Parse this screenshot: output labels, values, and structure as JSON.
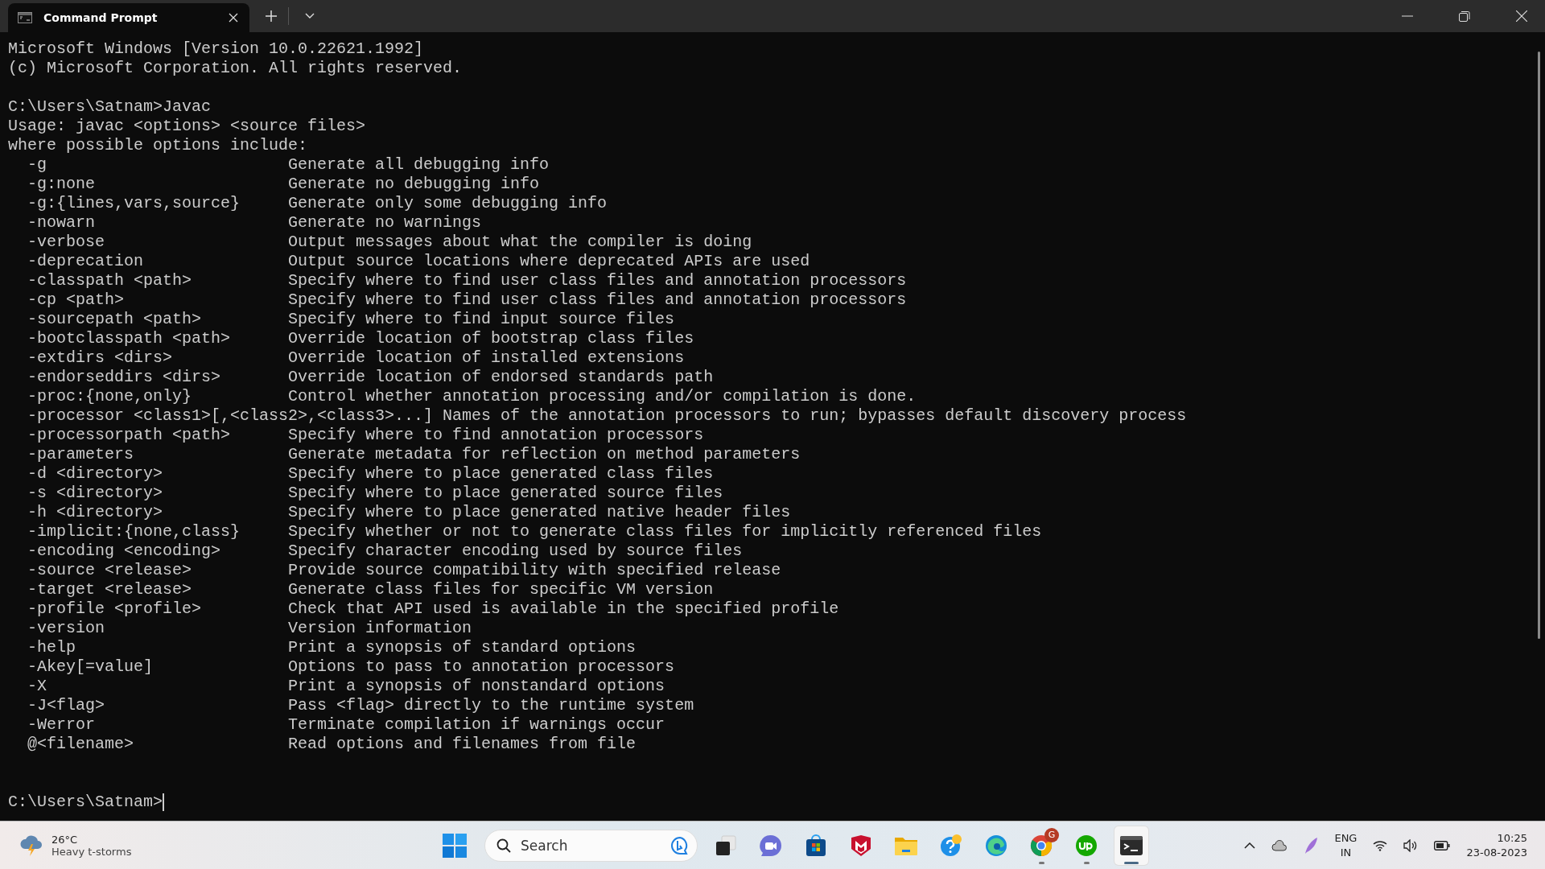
{
  "window": {
    "tab_title": "Command Prompt"
  },
  "terminal": {
    "lines": [
      {
        "kind": "text",
        "text": "Microsoft Windows [Version 10.0.22621.1992]"
      },
      {
        "kind": "text",
        "text": "(c) Microsoft Corporation. All rights reserved."
      },
      {
        "kind": "blank"
      },
      {
        "kind": "text",
        "text": "C:\\Users\\Satnam>Javac"
      },
      {
        "kind": "text",
        "text": "Usage: javac <options> <source files>"
      },
      {
        "kind": "text",
        "text": "where possible options include:"
      },
      {
        "kind": "option",
        "option": "-g",
        "description": "Generate all debugging info"
      },
      {
        "kind": "option",
        "option": "-g:none",
        "description": "Generate no debugging info"
      },
      {
        "kind": "option",
        "option": "-g:{lines,vars,source}",
        "description": "Generate only some debugging info"
      },
      {
        "kind": "option",
        "option": "-nowarn",
        "description": "Generate no warnings"
      },
      {
        "kind": "option",
        "option": "-verbose",
        "description": "Output messages about what the compiler is doing"
      },
      {
        "kind": "option",
        "option": "-deprecation",
        "description": "Output source locations where deprecated APIs are used"
      },
      {
        "kind": "option",
        "option": "-classpath <path>",
        "description": "Specify where to find user class files and annotation processors"
      },
      {
        "kind": "option",
        "option": "-cp <path>",
        "description": "Specify where to find user class files and annotation processors"
      },
      {
        "kind": "option",
        "option": "-sourcepath <path>",
        "description": "Specify where to find input source files"
      },
      {
        "kind": "option",
        "option": "-bootclasspath <path>",
        "description": "Override location of bootstrap class files"
      },
      {
        "kind": "option",
        "option": "-extdirs <dirs>",
        "description": "Override location of installed extensions"
      },
      {
        "kind": "option",
        "option": "-endorseddirs <dirs>",
        "description": "Override location of endorsed standards path"
      },
      {
        "kind": "option",
        "option": "-proc:{none,only}",
        "description": "Control whether annotation processing and/or compilation is done."
      },
      {
        "kind": "option",
        "option": "-processor <class1>[,<class2>,<class3>...]",
        "description": "Names of the annotation processors to run; bypasses default discovery process"
      },
      {
        "kind": "option",
        "option": "-processorpath <path>",
        "description": "Specify where to find annotation processors"
      },
      {
        "kind": "option",
        "option": "-parameters",
        "description": "Generate metadata for reflection on method parameters"
      },
      {
        "kind": "option",
        "option": "-d <directory>",
        "description": "Specify where to place generated class files"
      },
      {
        "kind": "option",
        "option": "-s <directory>",
        "description": "Specify where to place generated source files"
      },
      {
        "kind": "option",
        "option": "-h <directory>",
        "description": "Specify where to place generated native header files"
      },
      {
        "kind": "option",
        "option": "-implicit:{none,class}",
        "description": "Specify whether or not to generate class files for implicitly referenced files"
      },
      {
        "kind": "option",
        "option": "-encoding <encoding>",
        "description": "Specify character encoding used by source files"
      },
      {
        "kind": "option",
        "option": "-source <release>",
        "description": "Provide source compatibility with specified release"
      },
      {
        "kind": "option",
        "option": "-target <release>",
        "description": "Generate class files for specific VM version"
      },
      {
        "kind": "option",
        "option": "-profile <profile>",
        "description": "Check that API used is available in the specified profile"
      },
      {
        "kind": "option",
        "option": "-version",
        "description": "Version information"
      },
      {
        "kind": "option",
        "option": "-help",
        "description": "Print a synopsis of standard options"
      },
      {
        "kind": "option",
        "option": "-Akey[=value]",
        "description": "Options to pass to annotation processors"
      },
      {
        "kind": "option",
        "option": "-X",
        "description": "Print a synopsis of nonstandard options"
      },
      {
        "kind": "option",
        "option": "-J<flag>",
        "description": "Pass <flag> directly to the runtime system"
      },
      {
        "kind": "option",
        "option": "-Werror",
        "description": "Terminate compilation if warnings occur"
      },
      {
        "kind": "option",
        "option": "@<filename>",
        "description": "Read options and filenames from file"
      },
      {
        "kind": "blank"
      },
      {
        "kind": "blank"
      },
      {
        "kind": "prompt",
        "text": "C:\\Users\\Satnam>"
      }
    ]
  },
  "taskbar": {
    "weather": {
      "temperature": "26°C",
      "condition": "Heavy t-storms"
    },
    "search": {
      "placeholder": "Search"
    },
    "apps": [
      {
        "kind": "task-view",
        "running": false,
        "selected": false
      },
      {
        "kind": "chat",
        "running": false,
        "selected": false
      },
      {
        "kind": "store",
        "running": false,
        "selected": false
      },
      {
        "kind": "shield",
        "running": false,
        "selected": false
      },
      {
        "kind": "folder",
        "running": false,
        "selected": false
      },
      {
        "kind": "help",
        "running": false,
        "selected": false
      },
      {
        "kind": "edge",
        "running": false,
        "selected": false
      },
      {
        "kind": "chrome",
        "running": true,
        "selected": false,
        "badge": "G"
      },
      {
        "kind": "upwork",
        "running": true,
        "selected": false
      },
      {
        "kind": "terminal",
        "running": true,
        "selected": true
      }
    ],
    "language": {
      "code": "ENG",
      "region": "IN"
    },
    "time": "10:25",
    "date": "23-08-2023"
  }
}
